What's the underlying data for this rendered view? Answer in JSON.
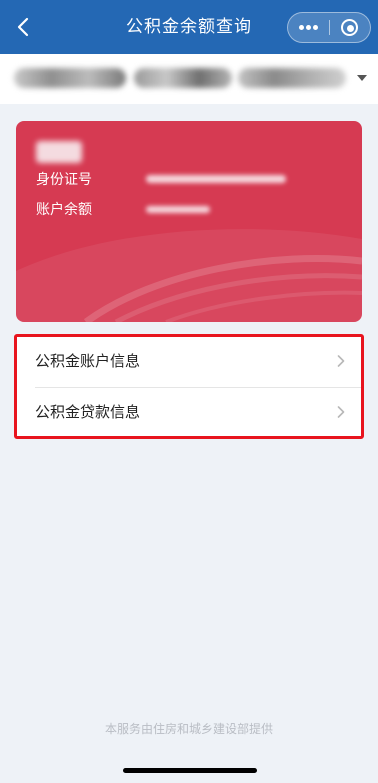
{
  "nav": {
    "title": "公积金余额查询",
    "back_icon": "chevron-left-icon",
    "more_icon": "more-dots-icon",
    "close_icon": "target-close-icon",
    "bar_color": "#2468b4"
  },
  "account_bar": {
    "value": "",
    "dropdown_icon": "caret-down-icon"
  },
  "card": {
    "background_color": "#d63a52",
    "name": "",
    "id_label": "身份证号",
    "id_value": "",
    "balance_label": "账户余额",
    "balance_value": ""
  },
  "menu": {
    "highlight_color": "#e8141e",
    "items": [
      {
        "label": "公积金账户信息",
        "icon": "chevron-right-icon"
      },
      {
        "label": "公积金贷款信息",
        "icon": "chevron-right-icon"
      }
    ]
  },
  "footer": {
    "text": "本服务由住房和城乡建设部提供"
  }
}
